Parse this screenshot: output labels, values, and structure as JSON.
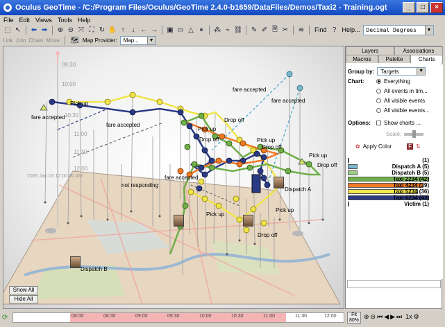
{
  "window": {
    "title": "Oculus GeoTime - /C:/Program Files/Oculus/GeoTime 2.4.0-b1659/DataFiles/Demos/Taxi2 - Training.ogt"
  },
  "menu": [
    "File",
    "Edit",
    "Views",
    "Tools",
    "Help"
  ],
  "toolbar": {
    "find_label": "Find",
    "help_label": "Help...",
    "coord_format": "Decimal Degrees"
  },
  "toolbar2": {
    "link_label": "Link",
    "join_label": "Join",
    "chain_label": "Chain",
    "move_label": "Move",
    "map_provider_label": "Map Provider:",
    "map_provider_value": "Map..."
  },
  "viewport": {
    "time_labels": [
      "09:30",
      "10:00",
      "10:30",
      "11:00",
      "11:30",
      "12:00"
    ],
    "date_label": "2005 Jan 03 12:00:00 AM",
    "annotations": [
      "fare accepted",
      "fare accepted",
      "fare accepted",
      "fare accepted",
      "Pick up",
      "Drop off",
      "Pick up",
      "Pick up",
      "Drop off",
      "Drop off",
      "Pick up",
      "Drop off",
      "fare accepted",
      "not responding",
      "Dispatch A",
      "Pick up",
      "Drop off",
      "Dispatch B",
      "Pick up"
    ],
    "show_all_label": "Show All",
    "hide_all_label": "Hide All"
  },
  "sidepanel": {
    "tabs_top": [
      "Layers",
      "Associations"
    ],
    "tabs_bottom": [
      "Macros",
      "Palette",
      "Charts"
    ],
    "group_by_label": "Group by:",
    "group_by_value": "Targets",
    "chart_label": "Chart:",
    "chart_options": [
      "Everything",
      "All events in tim...",
      "All visible events",
      "All visible events..."
    ],
    "options_label": "Options:",
    "show_charts_label": "Show charts ...",
    "scale_label": "Scale:",
    "apply_color_label": "Apply Color",
    "legend": [
      {
        "label": "(1)",
        "color": "#ffffff",
        "fraction": 0.02
      },
      {
        "label": "Dispatch A (5)",
        "color": "#7ab6c9",
        "fraction": 0.12
      },
      {
        "label": "Dispatch B (5)",
        "color": "#9ccf87",
        "fraction": 0.12
      },
      {
        "label": "Taxi 2234 (42)",
        "color": "#6fae48",
        "fraction": 1.0
      },
      {
        "label": "Taxi 4234 (39)",
        "color": "#f07a26",
        "fraction": 0.93
      },
      {
        "label": "Taxi 5234 (36)",
        "color": "#f2e84a",
        "fraction": 0.86
      },
      {
        "label": "Taxi 6234 (43)",
        "color": "#2a3a84",
        "fraction": 1.0
      },
      {
        "label": "Victim (1)",
        "color": "#6a2a2a",
        "fraction": 0.02
      }
    ]
  },
  "timeline": {
    "ticks": [
      "08:00",
      "08:30",
      "09:00",
      "09:30",
      "10:00",
      "10:30",
      "11:00",
      "11:30",
      "12:00"
    ],
    "fit_label": "Fit",
    "zoom_value": "80%",
    "speed_label": "1x"
  }
}
